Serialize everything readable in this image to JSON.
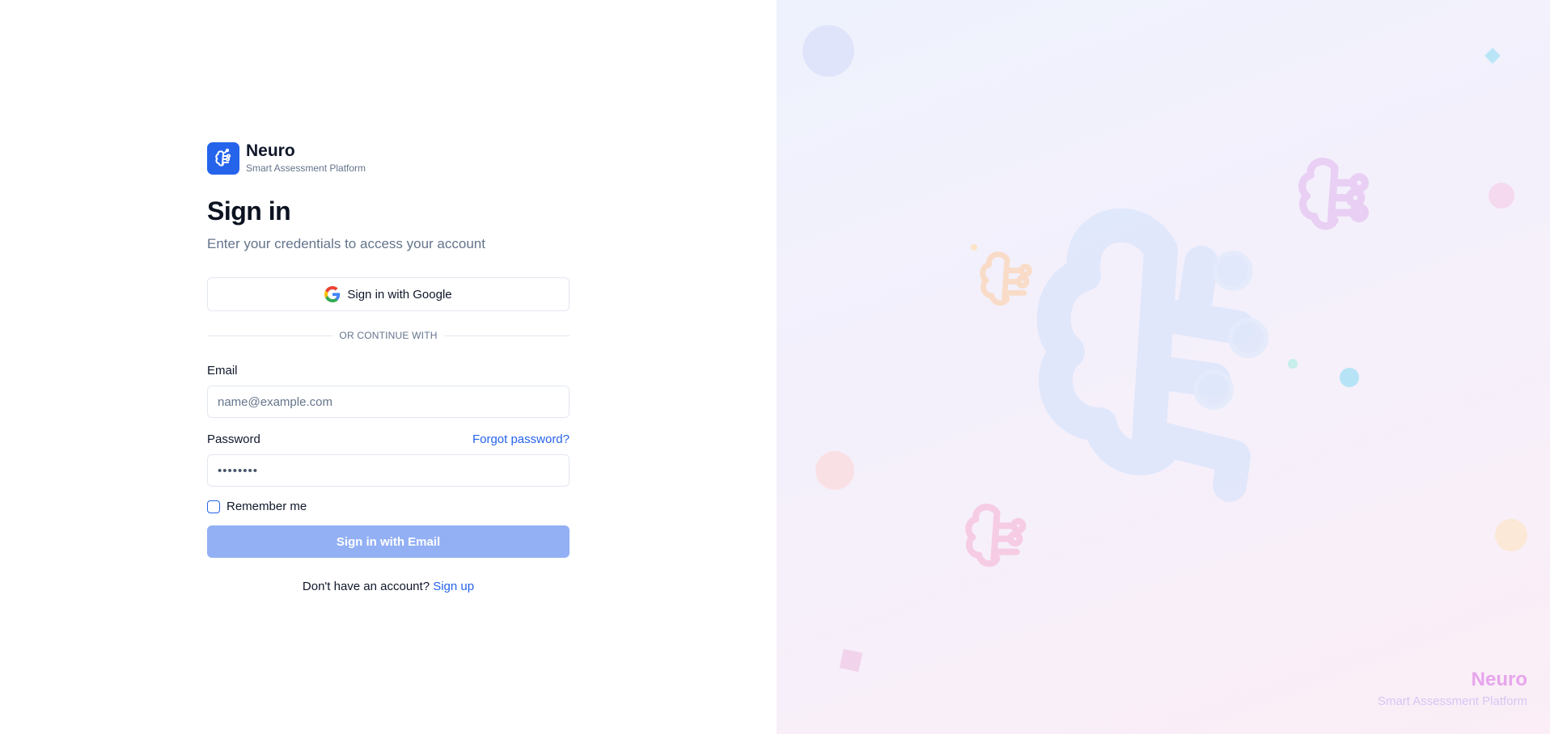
{
  "brand": {
    "name": "Neuro",
    "tagline": "Smart Assessment Platform"
  },
  "signin": {
    "title": "Sign in",
    "subtitle": "Enter your credentials to access your account",
    "google_button": "Sign in with Google",
    "divider": "OR CONTINUE WITH",
    "email_label": "Email",
    "email_placeholder": "name@example.com",
    "email_value": "",
    "password_label": "Password",
    "forgot_link": "Forgot password?",
    "password_value": "••••••••",
    "remember_label": "Remember me",
    "remember_checked": false,
    "submit_button": "Sign in with Email",
    "signup_prompt": "Don't have an account?",
    "signup_link": "Sign up"
  },
  "hero": {
    "watermark_name": "Neuro",
    "watermark_tagline": "Smart Assessment Platform"
  },
  "colors": {
    "primary": "#2563eb",
    "submit_disabled": "#93b0f4",
    "muted_text": "#64748b",
    "border": "#e2e8f0"
  },
  "icons": [
    "brain-logo-icon",
    "google-icon"
  ]
}
